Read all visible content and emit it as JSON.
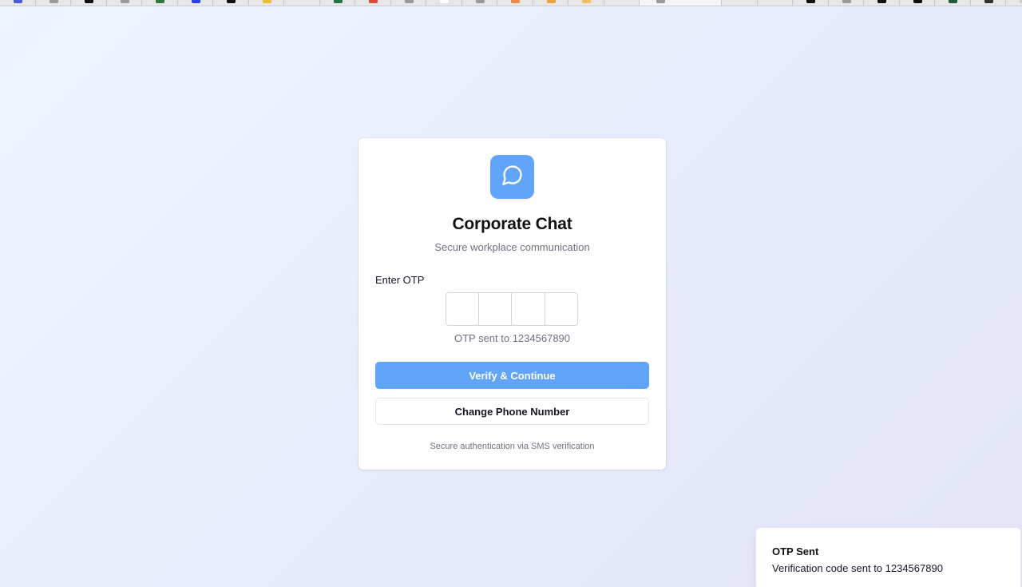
{
  "browser": {
    "tab_favicon_colors": [
      "#4a5be0",
      "#9a9a9a",
      "#111111",
      "#9a9a9a",
      "#2b7a3a",
      "#2740e8",
      "#111111",
      "#e8c12a",
      "#e6e6e6",
      "#1f7a4a",
      "#e04a3a",
      "#9a9a9a",
      "#ffffff",
      "#9a9a9a",
      "#f08a4a",
      "#f0a040",
      "#f0c060",
      "#e6e6e6",
      "#9a9a9a",
      "#e6e6e6",
      "#e6e6e6",
      "#111111",
      "#9a9a9a",
      "#111111",
      "#111111",
      "#1f5a3a",
      "#333333",
      "#cccccc"
    ],
    "active_tab_index": 18
  },
  "app": {
    "logo_icon": "chat-bubble-icon",
    "title": "Corporate Chat",
    "subtitle": "Secure workplace communication"
  },
  "otp": {
    "label": "Enter OTP",
    "digits": [
      "",
      "",
      "",
      ""
    ],
    "sent_text": "OTP sent to 1234567890"
  },
  "actions": {
    "verify_label": "Verify & Continue",
    "change_phone_label": "Change Phone Number"
  },
  "footnote": "Secure authentication via SMS verification",
  "toast": {
    "title": "OTP Sent",
    "description": "Verification code sent to 1234567890"
  },
  "colors": {
    "accent": "#60a5fa",
    "background": "#eaeefb"
  }
}
